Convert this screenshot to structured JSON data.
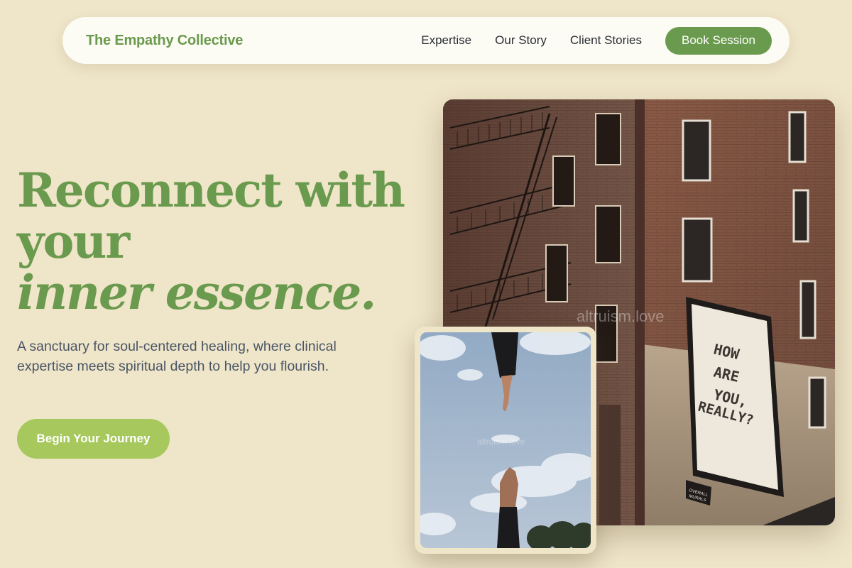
{
  "nav": {
    "brand": "The Empathy Collective",
    "links": [
      "Expertise",
      "Our Story",
      "Client Stories"
    ],
    "cta": "Book Session"
  },
  "hero": {
    "title_line1": "Reconnect with",
    "title_line2": "your",
    "title_line3": "inner essence.",
    "subtitle": "A sanctuary for soul-centered healing, where clinical expertise meets spiritual depth to help you flourish.",
    "cta": "Begin Your Journey"
  },
  "images": {
    "main": {
      "mural_lines": [
        "HOW",
        "ARE",
        "YOU,",
        "REALLY?"
      ],
      "sign_lines": [
        "OVERALL",
        "MURALS"
      ],
      "watermark": "altruism.love"
    },
    "secondary": {
      "watermark": "altruism.love"
    }
  },
  "colors": {
    "background": "#efe5c9",
    "brand_green": "#6a9a4d",
    "cta_light_green": "#a6c85c",
    "nav_bg": "#fcfbf4",
    "body_text": "#4a5566"
  }
}
